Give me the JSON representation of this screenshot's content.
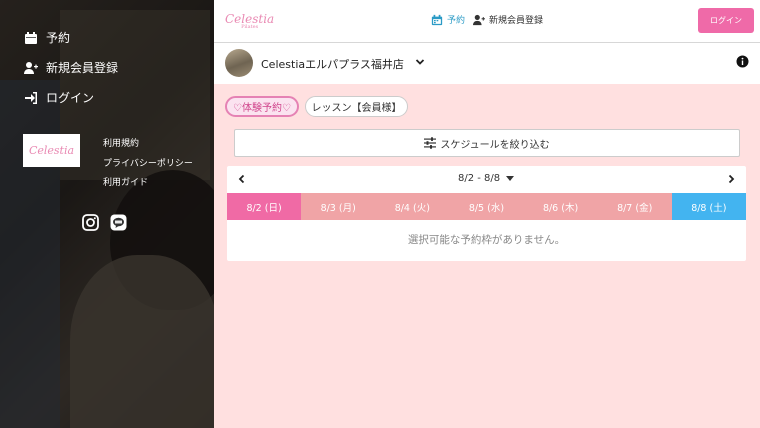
{
  "sidebar": {
    "nav": [
      {
        "label": "予約",
        "icon": "calendar-icon"
      },
      {
        "label": "新規会員登録",
        "icon": "user-plus-icon"
      },
      {
        "label": "ログイン",
        "icon": "sign-in-icon"
      }
    ],
    "logo_text": "Celestia",
    "footer_links": [
      "利用規約",
      "プライバシーポリシー",
      "利用ガイド"
    ],
    "social": [
      "instagram-icon",
      "line-icon"
    ]
  },
  "header": {
    "brand": "Celestia",
    "brand_sub": "Pilates",
    "nav_reserve": "予約",
    "nav_register": "新規会員登録",
    "login_button": "ログイン"
  },
  "store": {
    "name": "Celestiaエルパプラス福井店"
  },
  "tabs": [
    {
      "label": "♡体験予約♡",
      "active": true
    },
    {
      "label": "レッスン【会員様】",
      "active": false
    }
  ],
  "filter_button": "スケジュールを絞り込む",
  "calendar": {
    "range": "8/2 - 8/8",
    "days": [
      {
        "label": "8/2 (日)",
        "type": "sun"
      },
      {
        "label": "8/3 (月)",
        "type": "weekday"
      },
      {
        "label": "8/4 (火)",
        "type": "weekday"
      },
      {
        "label": "8/5 (水)",
        "type": "weekday"
      },
      {
        "label": "8/6 (木)",
        "type": "weekday"
      },
      {
        "label": "8/7 (金)",
        "type": "weekday"
      },
      {
        "label": "8/8 (土)",
        "type": "sat"
      }
    ],
    "empty_message": "選択可能な予約枠がありません。"
  },
  "colors": {
    "accent_pink": "#ef6aa8",
    "accent_blue": "#2b9bc6",
    "background": "#ffe0e0",
    "weekday": "#f0a4a6",
    "saturday": "#43b4f0"
  }
}
